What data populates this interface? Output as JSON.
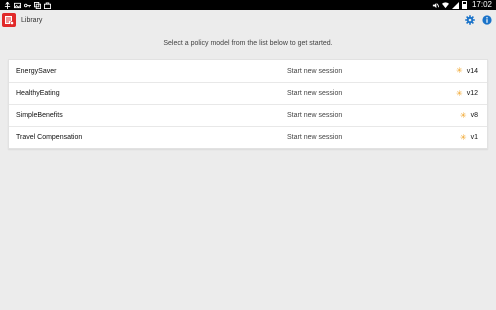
{
  "status_bar": {
    "time": "17:02",
    "left_icons": [
      "usb-icon",
      "image-icon",
      "key-icon",
      "copy-icon",
      "shopping-bag-icon"
    ],
    "right_icons": [
      "mute-icon",
      "wifi-icon",
      "signal-icon",
      "battery-icon"
    ]
  },
  "action_bar": {
    "title": "Library",
    "actions": [
      "settings-icon",
      "info-icon"
    ]
  },
  "instruction": "Select a policy model from the list below to get started.",
  "policies": [
    {
      "name": "EnergySaver",
      "action": "Start new session",
      "version": "v14"
    },
    {
      "name": "HealthyEating",
      "action": "Start new session",
      "version": "v12"
    },
    {
      "name": "SimpleBenefits",
      "action": "Start new session",
      "version": "v8"
    },
    {
      "name": "Travel Compensation",
      "action": "Start new session",
      "version": "v1"
    }
  ],
  "colors": {
    "accent": "#1a73c9",
    "brand": "#e12a2a",
    "version_star": "#f0a326",
    "background": "#ececec"
  }
}
